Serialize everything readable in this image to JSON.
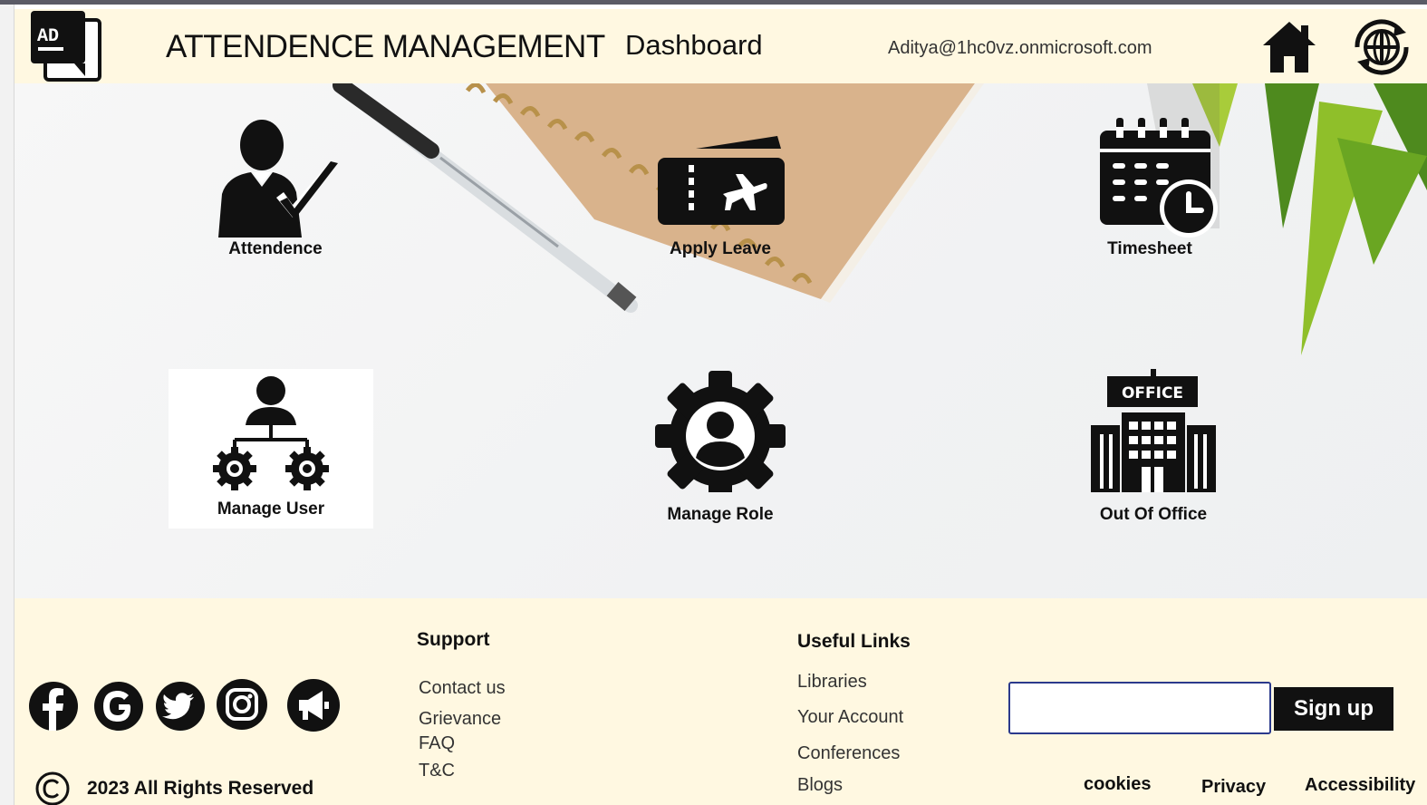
{
  "header": {
    "logo_text": "AD",
    "app_title": "ATTENDENCE MANAGEMENT",
    "page_title": "Dashboard",
    "user_email": "Aditya@1hc0vz.onmicrosoft.com",
    "home_icon": "home-icon",
    "globe_icon": "globe-refresh-icon"
  },
  "tiles": [
    {
      "label": "Attendence",
      "icon": "user-check-icon"
    },
    {
      "label": "Apply Leave",
      "icon": "plane-ticket-icon"
    },
    {
      "label": "Timesheet",
      "icon": "calendar-clock-icon"
    },
    {
      "label": "Manage User",
      "icon": "user-gears-icon"
    },
    {
      "label": "Manage Role",
      "icon": "gear-user-icon"
    },
    {
      "label": "Out Of Office",
      "icon": "office-building-icon",
      "badge": "OFFICE"
    }
  ],
  "footer": {
    "social_icons": [
      "facebook-icon",
      "google-icon",
      "twitter-icon",
      "instagram-icon",
      "megaphone-icon"
    ],
    "copyright": "2023 All Rights Reserved",
    "support": {
      "title": "Support",
      "links": [
        "Contact us",
        "Grievance",
        "FAQ",
        "T&C"
      ]
    },
    "useful_links": {
      "title": "Useful Links",
      "links": [
        "Libraries",
        "Your Account",
        "Conferences",
        "Blogs"
      ]
    },
    "signup": {
      "placeholder": "",
      "button_label": "Sign up"
    },
    "bottom_links": [
      "cookies",
      "Privacy",
      "Accessibility"
    ]
  },
  "colors": {
    "header_bg": "#fff8e1",
    "footer_bg": "#fff8e1",
    "input_border": "#2b3a8c",
    "button_bg": "#111111"
  }
}
